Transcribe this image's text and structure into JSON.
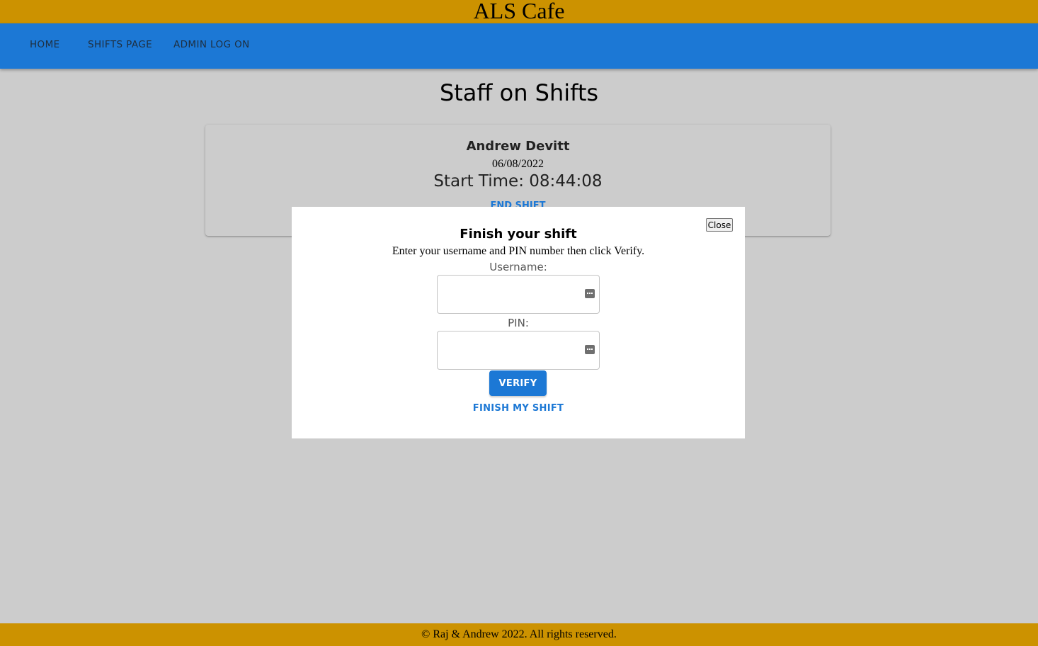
{
  "header": {
    "site_title": "ALS Cafe"
  },
  "nav": {
    "items": [
      "HOME",
      "SHIFTS PAGE",
      "ADMIN LOG ON"
    ]
  },
  "main": {
    "heading": "Staff on Shifts",
    "shift_card": {
      "name": "Andrew Devitt",
      "date": "06/08/2022",
      "start_time": "Start Time: 08:44:08",
      "end_shift_label": "END SHIFT"
    }
  },
  "modal": {
    "close_label": "Close",
    "title": "Finish your shift",
    "instructions": "Enter your username and PIN number then click Verify.",
    "username_label": "Username:",
    "username_value": "",
    "pin_label": "PIN:",
    "pin_value": "",
    "verify_label": "VERIFY",
    "finish_label": "FINISH MY SHIFT"
  },
  "footer": {
    "text": "© Raj & Andrew 2022. All rights reserved."
  },
  "colors": {
    "header_bar": "#cc9200",
    "nav_bar": "#1c78d5",
    "page_bg": "#cccccc",
    "accent": "#1c78d5"
  },
  "icons": {
    "field_icon": "password-manager-key-icon"
  }
}
